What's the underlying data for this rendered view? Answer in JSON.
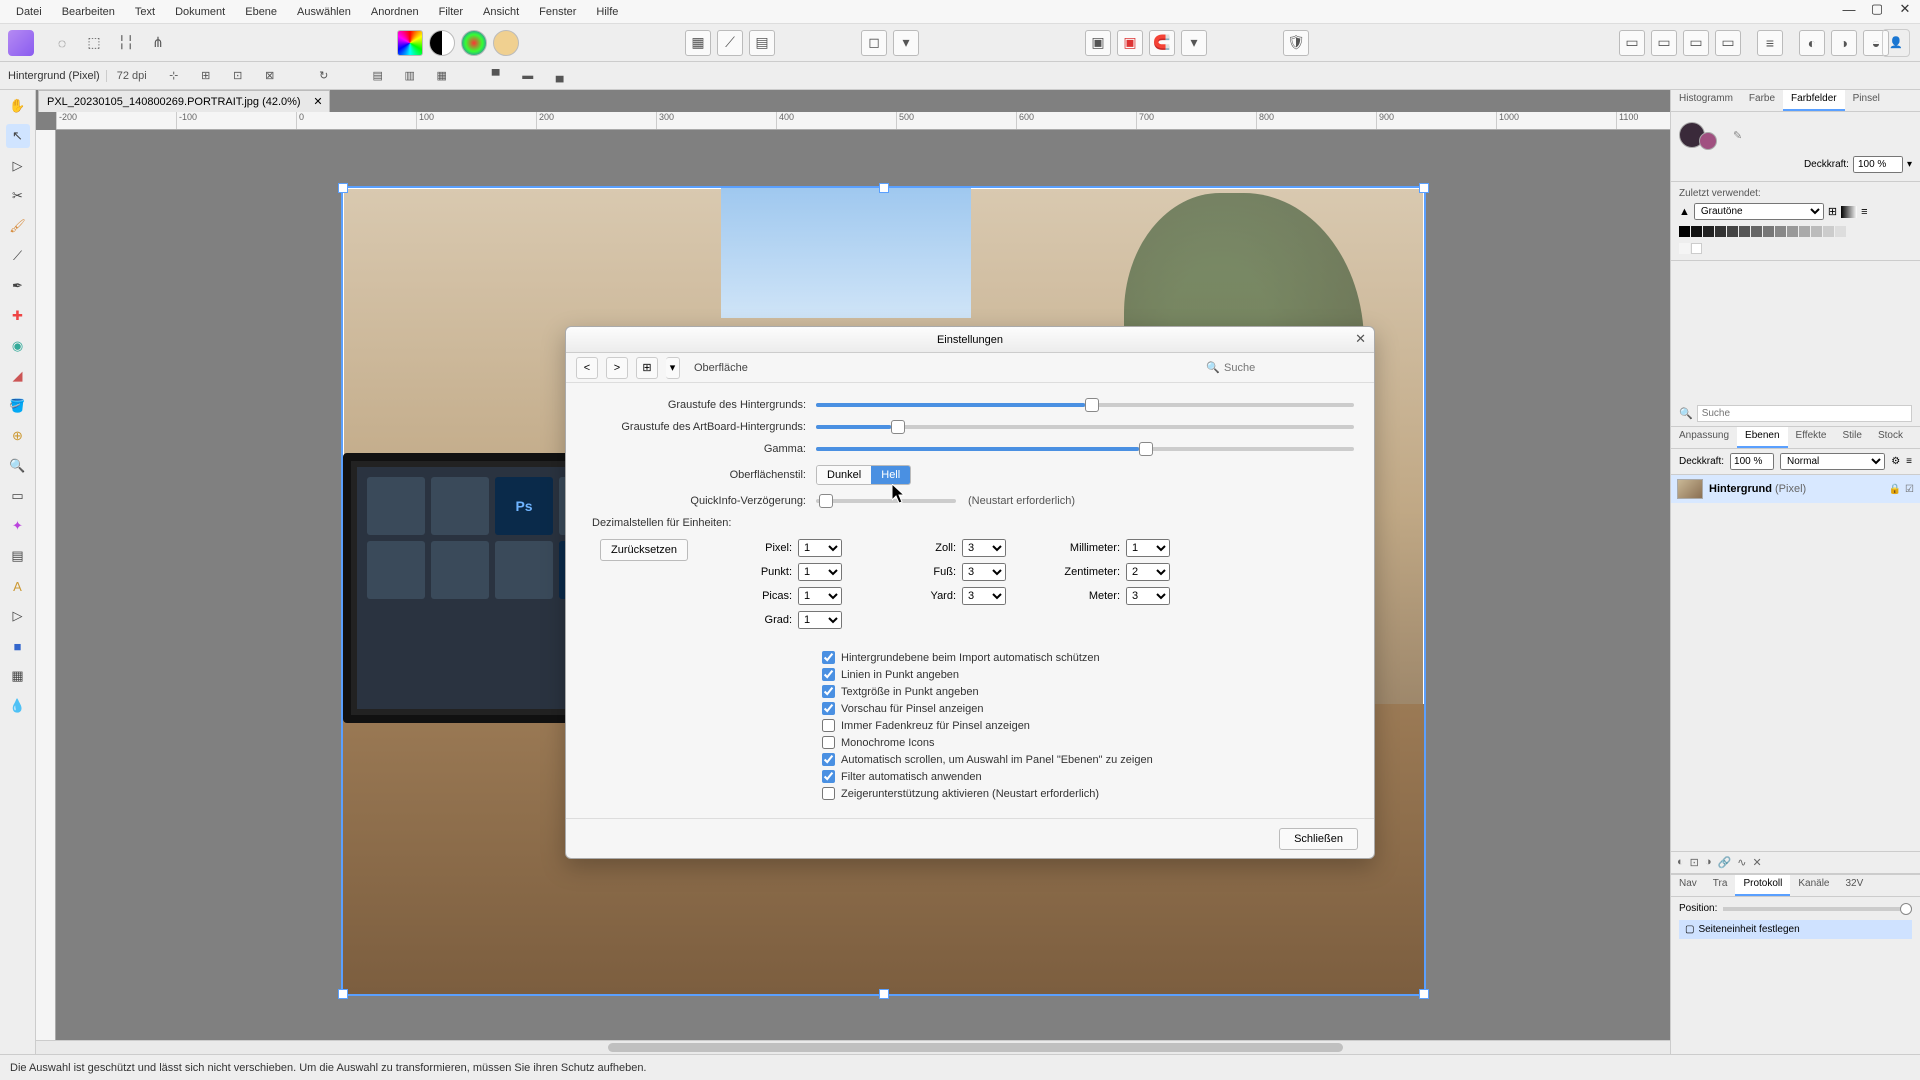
{
  "menubar": {
    "items": [
      "Datei",
      "Bearbeiten",
      "Text",
      "Dokument",
      "Ebene",
      "Auswählen",
      "Anordnen",
      "Filter",
      "Ansicht",
      "Fenster",
      "Hilfe"
    ]
  },
  "context": {
    "layer_label": "Hintergrund (Pixel)",
    "dpi": "72 dpi"
  },
  "doc_tab": {
    "filename": "PXL_20230105_140800269.PORTRAIT.jpg (42.0%)"
  },
  "ruler_ticks": [
    "-200",
    "-100",
    "0",
    "100",
    "200",
    "300",
    "400",
    "500",
    "600",
    "700",
    "800",
    "900",
    "1000",
    "1100"
  ],
  "right": {
    "top_tabs": [
      "Histogramm",
      "Farbe",
      "Farbfelder",
      "Pinsel"
    ],
    "opacity_label": "Deckkraft:",
    "opacity_value": "100 %",
    "recent_label": "Zuletzt verwendet:",
    "swatch_select": "Grautöne",
    "search_placeholder": "Suche",
    "layer_tabs": [
      "Anpassung",
      "Ebenen",
      "Effekte",
      "Stile",
      "Stock"
    ],
    "layer_opacity_label": "Deckkraft:",
    "layer_opacity_value": "100 %",
    "blend_mode": "Normal",
    "layer_name": "Hintergrund",
    "layer_type": "(Pixel)",
    "nav_tabs": [
      "Nav",
      "Tra",
      "Protokoll",
      "Kanäle",
      "32V"
    ],
    "position_label": "Position:",
    "history_item": "Seiteneinheit festlegen"
  },
  "dialog": {
    "title": "Einstellungen",
    "section": "Oberfläche",
    "search_placeholder": "Suche",
    "sliders": {
      "bg_gray": "Graustufe des Hintergrunds:",
      "artboard_gray": "Graustufe des ArtBoard-Hintergrunds:",
      "gamma": "Gamma:"
    },
    "style_label": "Oberflächenstil:",
    "style_options": [
      "Dunkel",
      "Hell"
    ],
    "tooltip_label": "QuickInfo-Verzögerung:",
    "restart_note": "(Neustart erforderlich)",
    "decimals_label": "Dezimalstellen für Einheiten:",
    "reset": "Zurücksetzen",
    "units": {
      "pixel": {
        "label": "Pixel:",
        "val": "1"
      },
      "punkt": {
        "label": "Punkt:",
        "val": "1"
      },
      "picas": {
        "label": "Picas:",
        "val": "1"
      },
      "grad": {
        "label": "Grad:",
        "val": "1"
      },
      "zoll": {
        "label": "Zoll:",
        "val": "3"
      },
      "fuss": {
        "label": "Fuß:",
        "val": "3"
      },
      "yard": {
        "label": "Yard:",
        "val": "3"
      },
      "mm": {
        "label": "Millimeter:",
        "val": "1"
      },
      "cm": {
        "label": "Zentimeter:",
        "val": "2"
      },
      "meter": {
        "label": "Meter:",
        "val": "3"
      }
    },
    "checks": {
      "c1": {
        "label": "Hintergrundebene beim Import automatisch schützen",
        "v": true
      },
      "c2": {
        "label": "Linien in Punkt angeben",
        "v": true
      },
      "c3": {
        "label": "Textgröße in Punkt angeben",
        "v": true
      },
      "c4": {
        "label": "Vorschau für Pinsel anzeigen",
        "v": true
      },
      "c5": {
        "label": "Immer Fadenkreuz für Pinsel anzeigen",
        "v": false
      },
      "c6": {
        "label": "Monochrome Icons",
        "v": false
      },
      "c7": {
        "label": "Automatisch scrollen, um Auswahl im Panel \"Ebenen\" zu zeigen",
        "v": true
      },
      "c8": {
        "label": "Filter automatisch anwenden",
        "v": true
      },
      "c9": {
        "label": "Zeigerunterstützung aktivieren (Neustart erforderlich)",
        "v": false
      }
    },
    "close_btn": "Schließen"
  },
  "status": "Die Auswahl ist geschützt und lässt sich nicht verschieben. Um die Auswahl zu transformieren, müssen Sie ihren Schutz aufheben."
}
